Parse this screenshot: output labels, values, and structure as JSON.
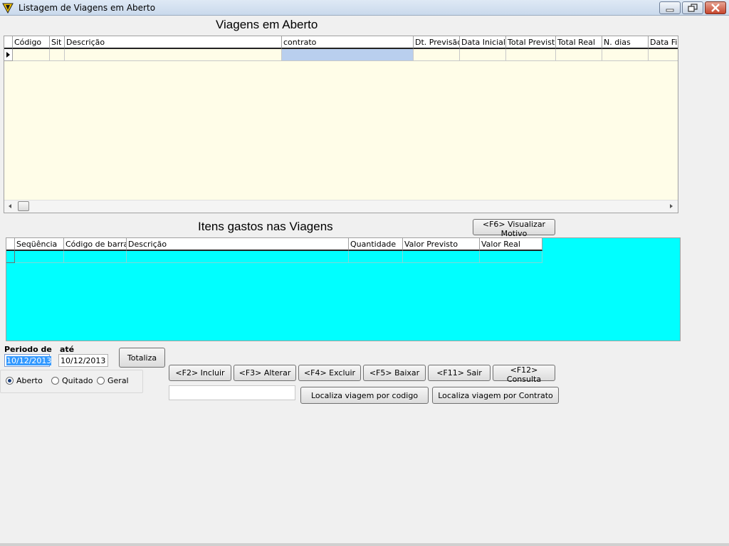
{
  "window": {
    "title": "Listagem de Viagens em Aberto"
  },
  "trips": {
    "title": "Viagens em Aberto",
    "columns": [
      "Código",
      "Sit",
      "Descrição",
      "contrato",
      "Dt. Previsão",
      "Data Inicial",
      "Total Previsto",
      "Total Real",
      "N. dias",
      "Data Fi"
    ],
    "row_bg": "#fffde8",
    "selected_cell_bg": "#b9cfee"
  },
  "items": {
    "title": "Itens gastos nas Viagens",
    "motivo_button": "<F6> Visualizar Motivo",
    "columns": [
      "Seqüência",
      "Código de barra",
      "Descrição",
      "Quantidade",
      "Valor Previsto",
      "Valor Real"
    ],
    "grid_bg": "#00ffff"
  },
  "period": {
    "from_label": "Periodo de",
    "to_label": "até",
    "from_value": "10/12/2013",
    "to_value": "10/12/2013",
    "totaliza": "Totaliza"
  },
  "status": {
    "options": [
      "Aberto",
      "Quitado",
      "Geral"
    ],
    "selected": "Aberto"
  },
  "actions": {
    "incluir": "<F2> Incluir",
    "alterar": "<F3> Alterar",
    "excluir": "<F4> Excluir",
    "baixar": "<F5> Baixar",
    "sair": "<F11> Sair",
    "consulta": "<F12> Consulta",
    "search_value": "",
    "localiza_codigo": "Localiza viagem por codigo",
    "localiza_contrato": "Localiza viagem por Contrato"
  }
}
